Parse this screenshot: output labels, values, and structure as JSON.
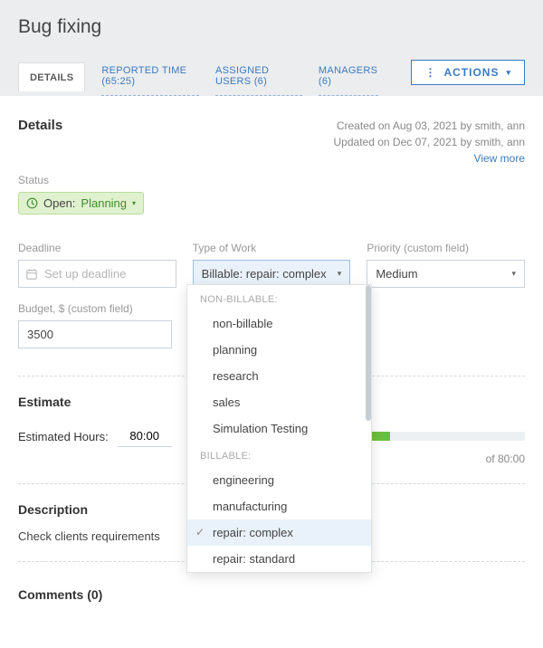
{
  "page_title": "Bug fixing",
  "tabs": {
    "details": "DETAILS",
    "reported_time": "REPORTED TIME (65:25)",
    "assigned_users": "ASSIGNED USERS (6)",
    "managers": "MANAGERS (6)"
  },
  "actions_button": "ACTIONS",
  "details": {
    "heading": "Details",
    "created": "Created on Aug 03, 2021 by smith, ann",
    "updated": "Updated on Dec 07, 2021 by smith, ann",
    "view_more": "View more",
    "status_label": "Status",
    "status_open": "Open:",
    "status_value": "Planning"
  },
  "fields": {
    "deadline_label": "Deadline",
    "deadline_placeholder": "Set up deadline",
    "type_label": "Type of Work",
    "type_value": "Billable: repair: complex",
    "priority_label": "Priority (custom field)",
    "priority_value": "Medium",
    "budget_label": "Budget, $ (custom field)",
    "budget_value": "3500"
  },
  "estimate": {
    "heading": "Estimate",
    "hours_label": "Estimated Hours:",
    "hours_value": "80:00",
    "of_value": "of 80:00"
  },
  "description": {
    "heading": "Description",
    "body": "Check clients requirements"
  },
  "comments": {
    "heading": "Comments (0)"
  },
  "dropdown": {
    "group1_title": "NON-BILLABLE:",
    "group1": [
      "non-billable",
      "planning",
      "research",
      "sales",
      "Simulation Testing"
    ],
    "group2_title": "BILLABLE:",
    "group2": [
      "engineering",
      "manufacturing",
      "repair: complex",
      "repair: standard"
    ],
    "selected": "repair: complex"
  }
}
